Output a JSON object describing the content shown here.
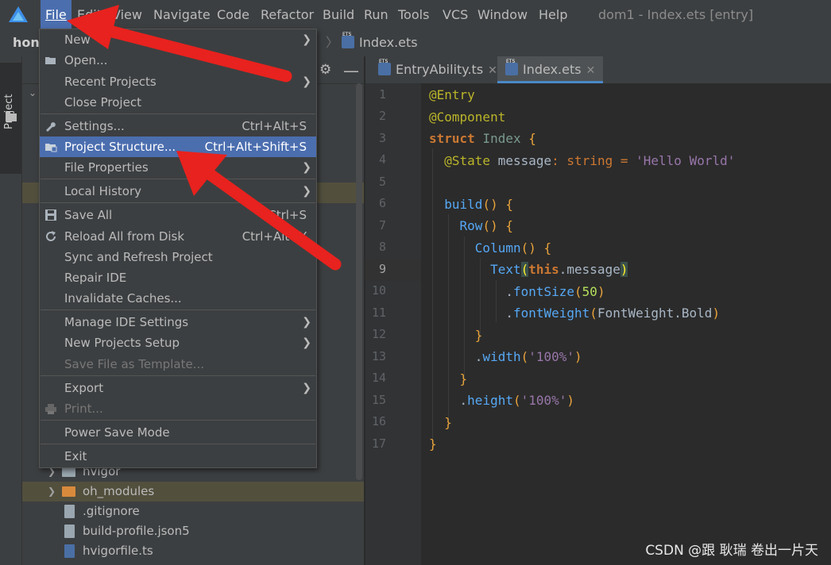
{
  "app": {
    "window_title": "dom1 - Index.ets [entry]",
    "menu": [
      "File",
      "Edit",
      "View",
      "Navigate",
      "Code",
      "Refactor",
      "Build",
      "Run",
      "Tools",
      "VCS",
      "Window",
      "Help"
    ],
    "active_menu": "File"
  },
  "navbar": {
    "project_name": "hong",
    "breadcrumb_file": "Index.ets"
  },
  "left_strip": {
    "project_tab": "Project"
  },
  "editor_tabs": [
    {
      "label": "EntryAbility.ts",
      "active": false
    },
    {
      "label": "Index.ets",
      "active": true
    }
  ],
  "file_menu": {
    "items": [
      {
        "label": "New",
        "shortcut": "",
        "submenu": true,
        "disabled": false,
        "selected": false
      },
      {
        "label": "Open...",
        "shortcut": "",
        "submenu": false,
        "disabled": false,
        "selected": false
      },
      {
        "label": "Recent Projects",
        "shortcut": "",
        "submenu": true,
        "disabled": false,
        "selected": false
      },
      {
        "label": "Close Project",
        "shortcut": "",
        "submenu": false,
        "disabled": false,
        "selected": false
      },
      {
        "label": "Settings...",
        "shortcut": "Ctrl+Alt+S",
        "submenu": false,
        "disabled": false,
        "selected": false
      },
      {
        "label": "Project Structure...",
        "shortcut": "Ctrl+Alt+Shift+S",
        "submenu": false,
        "disabled": false,
        "selected": true
      },
      {
        "label": "File Properties",
        "shortcut": "",
        "submenu": true,
        "disabled": false,
        "selected": false
      },
      {
        "label": "Local History",
        "shortcut": "",
        "submenu": true,
        "disabled": false,
        "selected": false
      },
      {
        "label": "Save All",
        "shortcut": "Ctrl+S",
        "submenu": false,
        "disabled": false,
        "selected": false
      },
      {
        "label": "Reload All from Disk",
        "shortcut": "Ctrl+Alt+Y",
        "submenu": false,
        "disabled": false,
        "selected": false
      },
      {
        "label": "Sync and Refresh Project",
        "shortcut": "",
        "submenu": false,
        "disabled": false,
        "selected": false
      },
      {
        "label": "Repair IDE",
        "shortcut": "",
        "submenu": false,
        "disabled": false,
        "selected": false
      },
      {
        "label": "Invalidate Caches...",
        "shortcut": "",
        "submenu": false,
        "disabled": false,
        "selected": false
      },
      {
        "label": "Manage IDE Settings",
        "shortcut": "",
        "submenu": true,
        "disabled": false,
        "selected": false
      },
      {
        "label": "New Projects Setup",
        "shortcut": "",
        "submenu": true,
        "disabled": false,
        "selected": false
      },
      {
        "label": "Save File as Template...",
        "shortcut": "",
        "submenu": false,
        "disabled": true,
        "selected": false
      },
      {
        "label": "Export",
        "shortcut": "",
        "submenu": true,
        "disabled": false,
        "selected": false
      },
      {
        "label": "Print...",
        "shortcut": "",
        "submenu": false,
        "disabled": true,
        "selected": false
      },
      {
        "label": "Power Save Mode",
        "shortcut": "",
        "submenu": false,
        "disabled": false,
        "selected": false
      },
      {
        "label": "Exit",
        "shortcut": "",
        "submenu": false,
        "disabled": false,
        "selected": false
      }
    ]
  },
  "project_tree": [
    {
      "label": "hvigor",
      "type": "folder",
      "expandable": true
    },
    {
      "label": "oh_modules",
      "type": "folder-orange",
      "expandable": true
    },
    {
      "label": ".gitignore",
      "type": "file",
      "expandable": false
    },
    {
      "label": "build-profile.json5",
      "type": "file",
      "expandable": false
    },
    {
      "label": "hvigorfile.ts",
      "type": "ts-file",
      "expandable": false
    }
  ],
  "editor": {
    "line_numbers": [
      "1",
      "2",
      "3",
      "4",
      "5",
      "6",
      "7",
      "8",
      "9",
      "10",
      "11",
      "12",
      "13",
      "14",
      "15",
      "16",
      "17"
    ],
    "current_line": "9",
    "code": {
      "l1": "@Entry",
      "l2": "@Component",
      "l3_kw": "struct",
      "l3_name": "Index",
      "l3_brace": "{",
      "l4_ann": "@State",
      "l4_var": "message",
      "l4_colon": ":",
      "l4_type": "string",
      "l4_eq": "=",
      "l4_str": "'Hello World'",
      "l6_fn": "build",
      "l6_rest": "() {",
      "l7_fn": "Row",
      "l7_rest": "() {",
      "l8_fn": "Column",
      "l8_rest": "() {",
      "l9_fn": "Text",
      "l9_open": "(",
      "l9_this": "this",
      "l9_msg": ".message",
      "l9_close": ")",
      "l10_dot": ".",
      "l10_fn": "fontSize",
      "l10_open": "(",
      "l10_num": "50",
      "l10_close": ")",
      "l11_dot": ".",
      "l11_fn": "fontWeight",
      "l11_open": "(",
      "l11_arg": "FontWeight.Bold",
      "l11_close": ")",
      "l12": "}",
      "l13_dot": ".",
      "l13_fn": "width",
      "l13_open": "(",
      "l13_str": "'100%'",
      "l13_close": ")",
      "l14": "}",
      "l15_dot": ".",
      "l15_fn": "height",
      "l15_open": "(",
      "l15_str": "'100%'",
      "l15_close": ")",
      "l16": "}",
      "l17": "}"
    }
  },
  "watermark": "CSDN @跟 耿瑞 卷出一片天",
  "colors": {
    "accent": "#4b6eaf",
    "annotation_arrow": "#e8221e",
    "background": "#2b2b2b",
    "panel": "#3c3f41"
  }
}
